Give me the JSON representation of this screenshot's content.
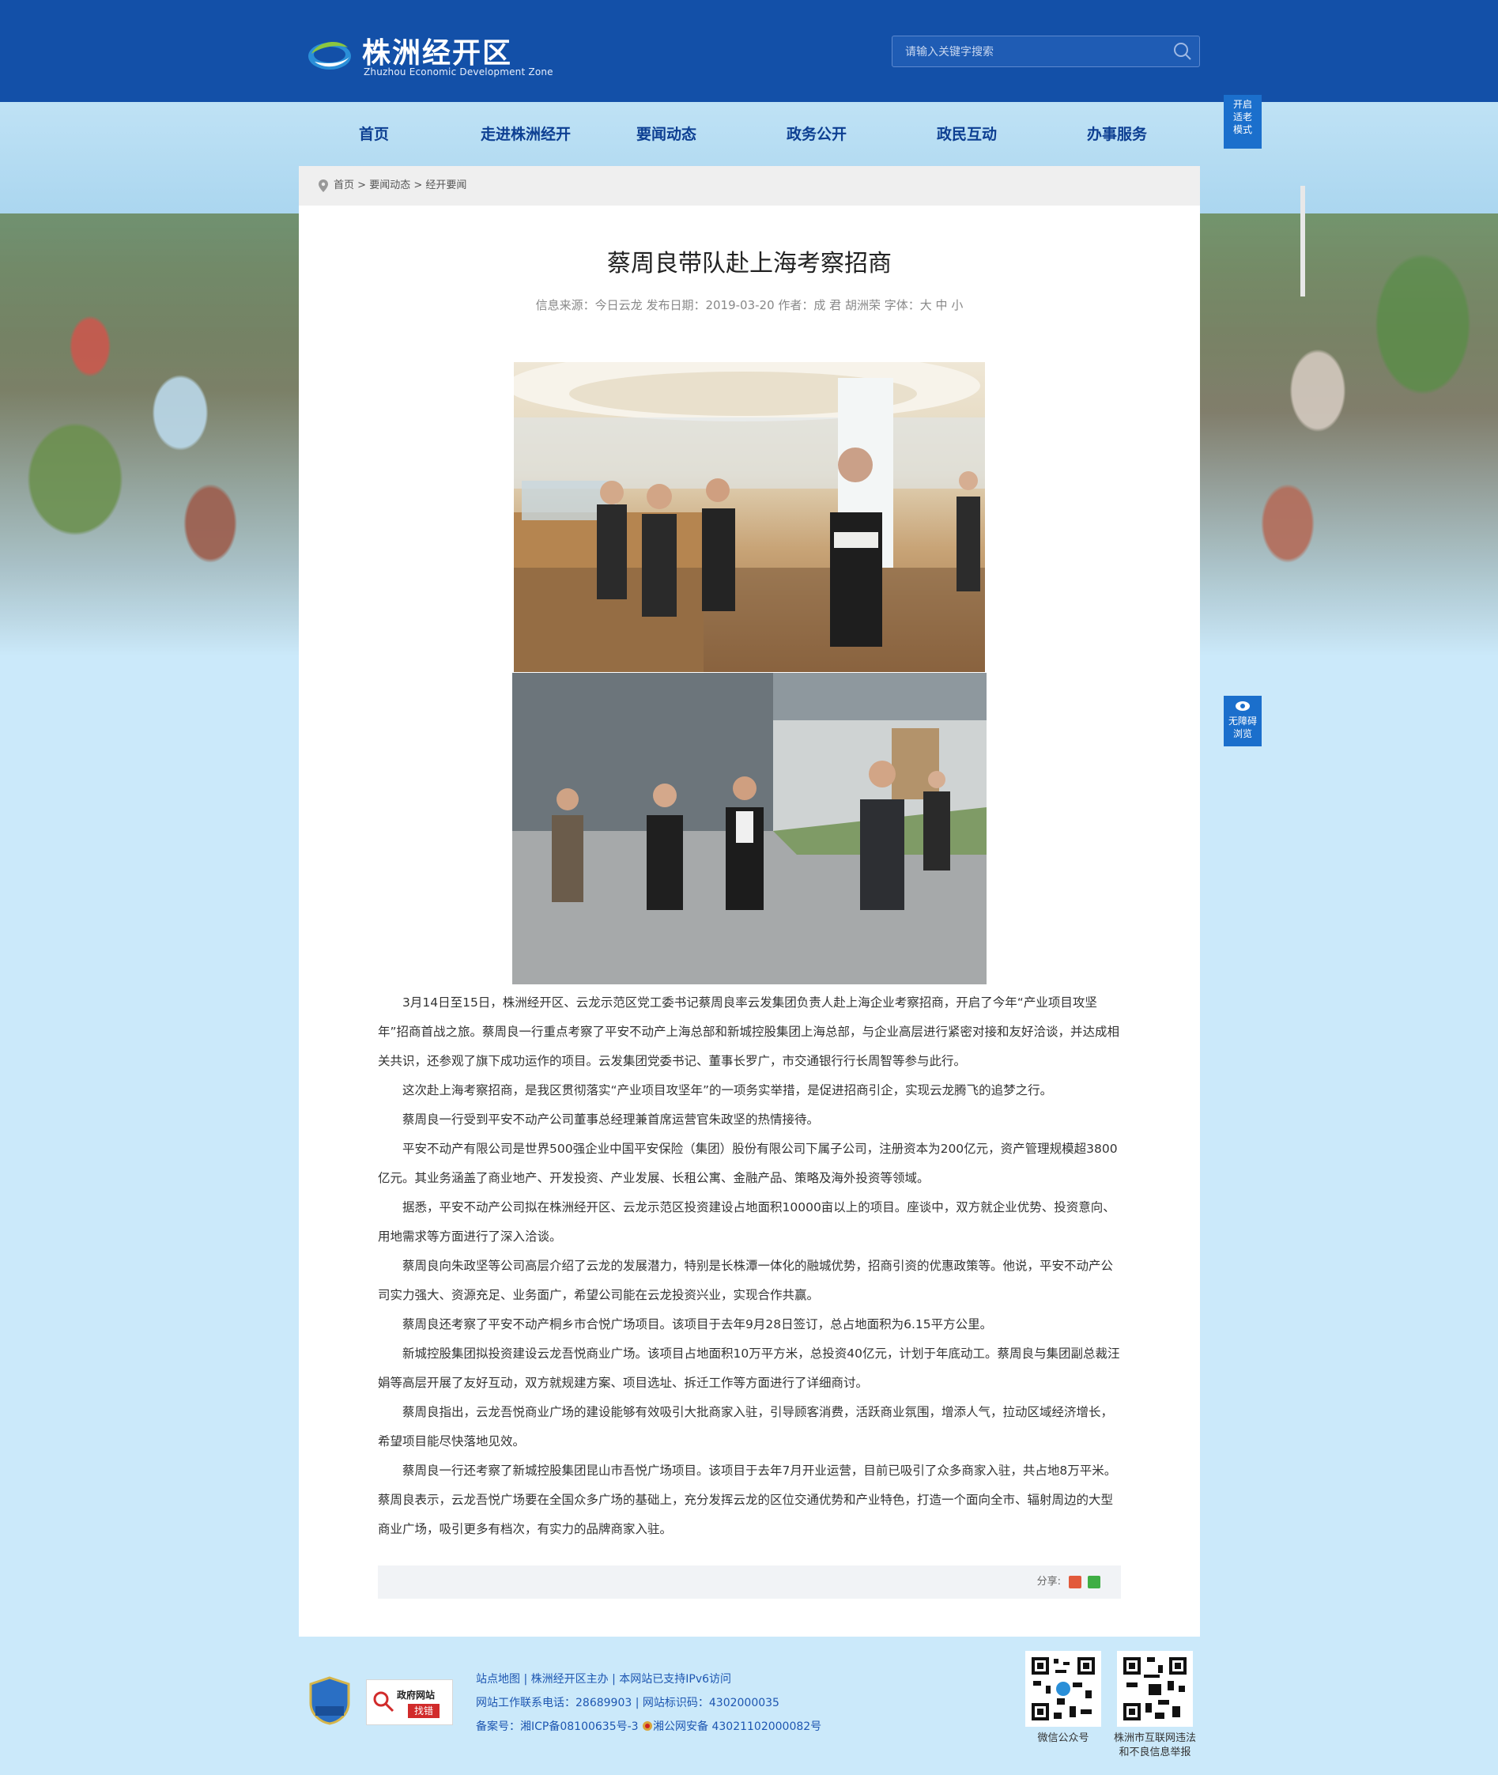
{
  "header": {
    "logo_cn": "株洲经开区",
    "logo_en": "Zhuzhou Economic Development Zone",
    "search_placeholder": "请输入关键字搜索"
  },
  "nav": {
    "items": [
      {
        "label": "首页"
      },
      {
        "label": "走进株洲经开"
      },
      {
        "label": "要闻动态"
      },
      {
        "label": "政务公开"
      },
      {
        "label": "政民互动"
      },
      {
        "label": "办事服务"
      }
    ]
  },
  "side_buttons": {
    "elder_mode": [
      "开启",
      "适老",
      "模式"
    ],
    "accessible": [
      "无障碍",
      "浏览"
    ]
  },
  "breadcrumb": {
    "items": [
      "首页",
      "要闻动态",
      "经开要闻"
    ],
    "sep": " > "
  },
  "article": {
    "title": "蔡周良带队赴上海考察招商",
    "meta_source": "信息来源：今日云龙",
    "meta_date": "发布日期：2019-03-20",
    "meta_author": "作者：成 君 胡洲荣",
    "meta_font_label": "字体：",
    "font_sizes": [
      "大",
      "中",
      "小"
    ],
    "paragraphs": [
      "3月14日至15日，株洲经开区、云龙示范区党工委书记蔡周良率云发集团负责人赴上海企业考察招商，开启了今年“产业项目攻坚年”招商首战之旅。蔡周良一行重点考察了平安不动产上海总部和新城控股集团上海总部，与企业高层进行紧密对接和友好洽谈，并达成相关共识，还参观了旗下成功运作的项目。云发集团党委书记、董事长罗广，市交通银行行长周智等参与此行。",
      "这次赴上海考察招商，是我区贯彻落实“产业项目攻坚年”的一项务实举措，是促进招商引企，实现云龙腾飞的追梦之行。",
      "蔡周良一行受到平安不动产公司董事总经理兼首席运营官朱政坚的热情接待。",
      "平安不动产有限公司是世界500强企业中国平安保险（集团）股份有限公司下属子公司，注册资本为200亿元，资产管理规模超3800亿元。其业务涵盖了商业地产、开发投资、产业发展、长租公寓、金融产品、策略及海外投资等领域。",
      "据悉，平安不动产公司拟在株洲经开区、云龙示范区投资建设占地面积10000亩以上的项目。座谈中，双方就企业优势、投资意向、用地需求等方面进行了深入洽谈。",
      "蔡周良向朱政坚等公司高层介绍了云龙的发展潜力，特别是长株潭一体化的融城优势，招商引资的优惠政策等。他说，平安不动产公司实力强大、资源充足、业务面广，希望公司能在云龙投资兴业，实现合作共赢。",
      "蔡周良还考察了平安不动产桐乡市合悦广场项目。该项目于去年9月28日签订，总占地面积为6.15平方公里。",
      "新城控股集团拟投资建设云龙吾悦商业广场。该项目占地面积10万平方米，总投资40亿元，计划于年底动工。蔡周良与集团副总裁汪娟等高层开展了友好互动，双方就规建方案、项目选址、拆迁工作等方面进行了详细商讨。",
      "蔡周良指出，云龙吾悦商业广场的建设能够有效吸引大批商家入驻，引导顾客消费，活跃商业氛围，增添人气，拉动区域经济增长，希望项目能尽快落地见效。",
      "蔡周良一行还考察了新城控股集团昆山市吾悦广场项目。该项目于去年7月开业运营，目前已吸引了众多商家入驻，共占地8万平米。蔡周良表示，云龙吾悦广场要在全国众多广场的基础上，充分发挥云龙的区位交通优势和产业特色，打造一个面向全市、辐射周边的大型商业广场，吸引更多有档次，有实力的品牌商家入驻。"
    ],
    "share_label": "分享:"
  },
  "footer": {
    "badge1_label": "事业单位",
    "badge2_line1": "政府网站",
    "badge2_line2": "找错",
    "line1": [
      "站点地图",
      "株洲经开区主办",
      "本网站已支持IPv6访问"
    ],
    "line2_phone": "网站工作联系电话：28689903",
    "line2_code": "网站标识码：4302000035",
    "line3_icp_label": "备案号：",
    "line3_icp": "湘ICP备08100635号-3",
    "line3_police": "湘公网安备 43021102000082号",
    "qr1_caption": "微信公众号",
    "qr2_caption_1": "株洲市互联网违法",
    "qr2_caption_2": "和不良信息举报"
  },
  "colors": {
    "header_bg": "#1350a8",
    "nav_text": "#0d3f92",
    "footer_link": "#1d56b1",
    "page_bg": "#cbe9fa"
  }
}
